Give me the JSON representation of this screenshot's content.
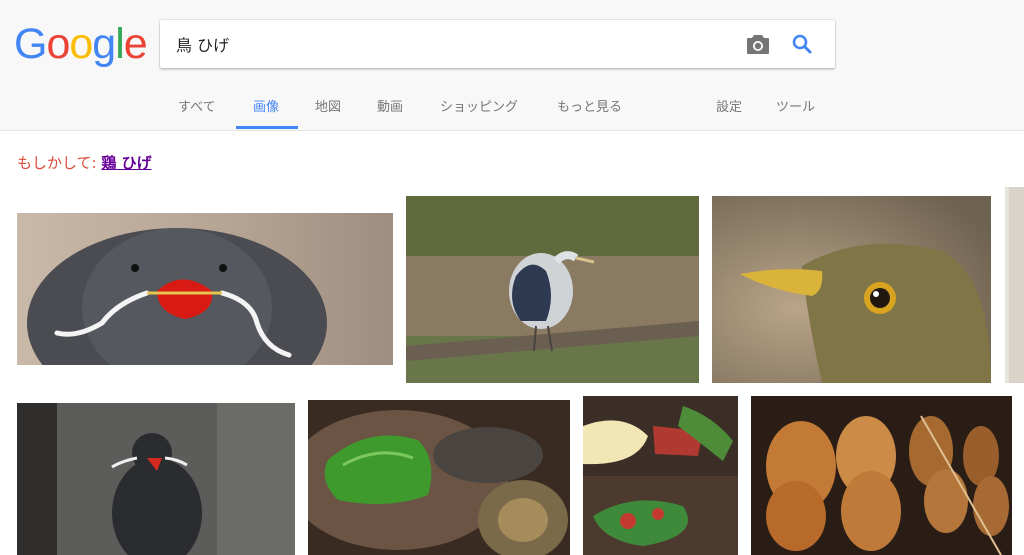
{
  "logo": {
    "letters": [
      "G",
      "o",
      "o",
      "g",
      "l",
      "e"
    ],
    "colors": [
      "#4285f4",
      "#ea4335",
      "#fbbc05",
      "#4285f4",
      "#34a853",
      "#ea4335"
    ]
  },
  "search": {
    "query": "鳥 ひげ",
    "camera_icon": "camera-icon",
    "search_icon": "search-icon"
  },
  "tabs": {
    "all": "すべて",
    "images": "画像",
    "maps": "地図",
    "videos": "動画",
    "shopping": "ショッピング",
    "more": "もっと見る",
    "settings": "設定",
    "tools": "ツール"
  },
  "spell": {
    "prefix": "もしかして:",
    "suggestion": "鶏 ひげ"
  },
  "images": [
    {
      "subject": "inca tern with mustache"
    },
    {
      "subject": "grey heron in field"
    },
    {
      "subject": "thrush close-up"
    },
    {
      "subject": "inca tern on rock"
    },
    {
      "subject": "grilled peppers"
    },
    {
      "subject": "sashimi dish"
    },
    {
      "subject": "yakitori skewers"
    }
  ]
}
